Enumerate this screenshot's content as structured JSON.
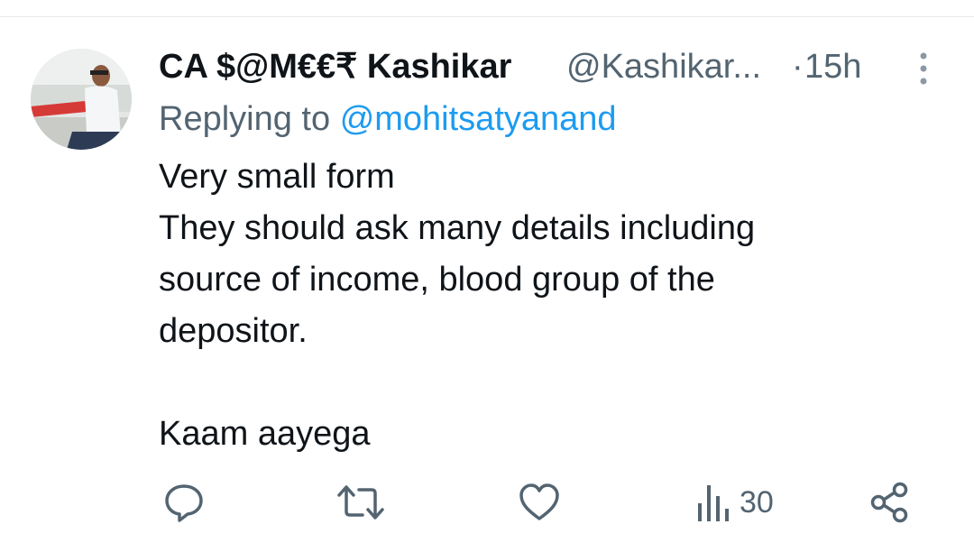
{
  "tweet": {
    "display_name": "CA $@M€€₹ Kashikar",
    "handle": "@Kashikar...",
    "separator": "·",
    "time": "15h",
    "replying_prefix": "Replying to",
    "replying_to": "@mohitsatyanand",
    "lines": [
      "Very small form",
      "They should ask many details including",
      "source of income, blood group of the",
      "depositor.",
      "",
      "Kaam aayega"
    ]
  },
  "actions": {
    "reply_icon": "reply-icon",
    "retweet_icon": "retweet-icon",
    "like_icon": "heart-icon",
    "views_icon": "views-icon",
    "views_count": "30",
    "share_icon": "share-icon"
  },
  "colors": {
    "text": "#0f1419",
    "secondary": "#536471",
    "link": "#1d9bf0"
  }
}
